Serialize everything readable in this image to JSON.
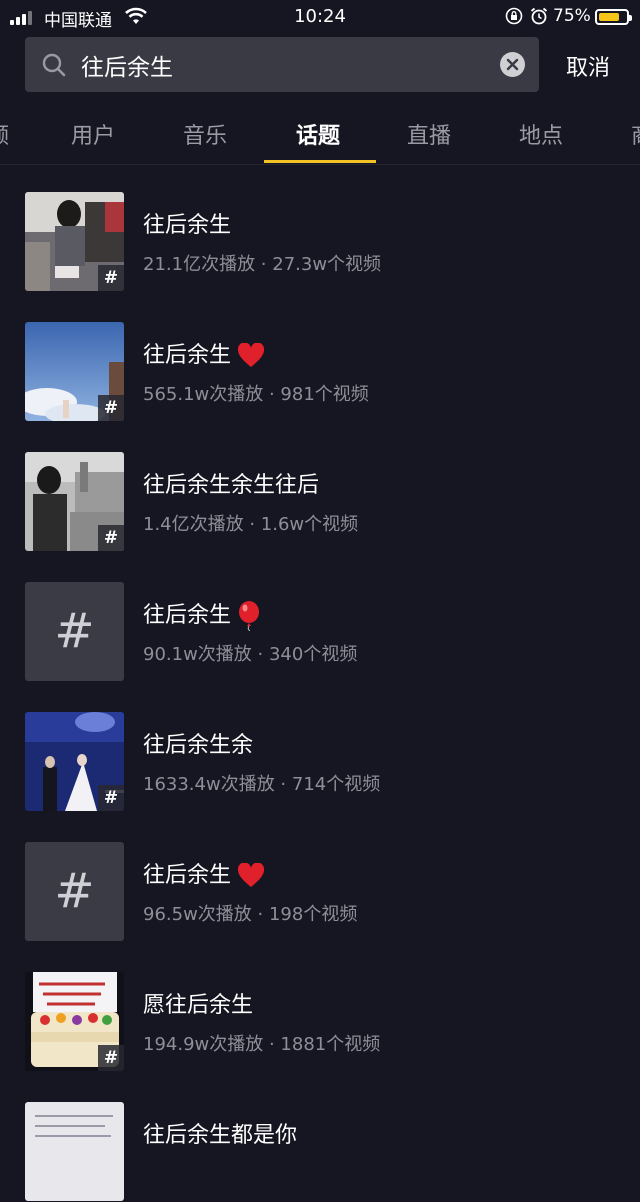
{
  "status_bar": {
    "carrier": "中国联通",
    "time": "10:24",
    "battery_percent": "75%",
    "battery_level": 0.75,
    "battery_color": "#f5c518"
  },
  "search": {
    "query": "往后余生",
    "cancel_label": "取消",
    "icon": "search-icon"
  },
  "tabs": [
    {
      "label": "频"
    },
    {
      "label": "用户"
    },
    {
      "label": "音乐"
    },
    {
      "label": "话题",
      "active": true
    },
    {
      "label": "直播"
    },
    {
      "label": "地点"
    },
    {
      "label": "商"
    }
  ],
  "accent_color": "#f2c227",
  "results": [
    {
      "title": "往后余生",
      "meta": "21.1亿次播放 · 27.3w个视频",
      "thumb": "image",
      "emoji": ""
    },
    {
      "title": "往后余生",
      "meta": "565.1w次播放 · 981个视频",
      "thumb": "image",
      "emoji": "heart"
    },
    {
      "title": "往后余生余生往后",
      "meta": "1.4亿次播放 · 1.6w个视频",
      "thumb": "image",
      "emoji": ""
    },
    {
      "title": "往后余生",
      "meta": "90.1w次播放 · 340个视频",
      "thumb": "placeholder",
      "emoji": "balloon"
    },
    {
      "title": "往后余生余",
      "meta": "1633.4w次播放 · 714个视频",
      "thumb": "image",
      "emoji": ""
    },
    {
      "title": "往后余生",
      "meta": "96.5w次播放 · 198个视频",
      "thumb": "placeholder",
      "emoji": "heart"
    },
    {
      "title": "愿往后余生",
      "meta": "194.9w次播放 · 1881个视频",
      "thumb": "image",
      "emoji": ""
    },
    {
      "title": "往后余生都是你",
      "meta": "",
      "thumb": "image",
      "emoji": ""
    }
  ],
  "hash_symbol": "#"
}
